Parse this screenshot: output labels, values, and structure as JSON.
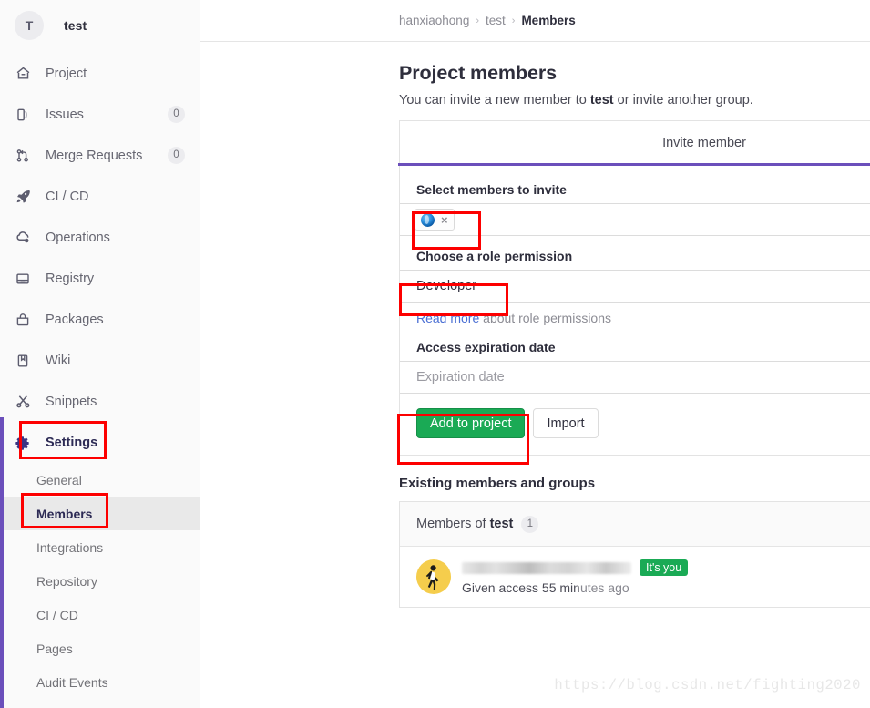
{
  "sidebar": {
    "project": {
      "initial": "T",
      "name": "test"
    },
    "nav": [
      {
        "label": "Project",
        "icon": "home-icon",
        "count": null
      },
      {
        "label": "Issues",
        "icon": "issues-icon",
        "count": "0"
      },
      {
        "label": "Merge Requests",
        "icon": "merge-request-icon",
        "count": "0"
      },
      {
        "label": "CI / CD",
        "icon": "rocket-icon",
        "count": null
      },
      {
        "label": "Operations",
        "icon": "cloud-gear-icon",
        "count": null
      },
      {
        "label": "Registry",
        "icon": "package-box-icon",
        "count": null
      },
      {
        "label": "Packages",
        "icon": "packages-icon",
        "count": null
      },
      {
        "label": "Wiki",
        "icon": "book-icon",
        "count": null
      },
      {
        "label": "Snippets",
        "icon": "scissors-icon",
        "count": null
      }
    ],
    "settings": {
      "label": "Settings",
      "icon": "gear-icon"
    },
    "sub_items": [
      {
        "label": "General",
        "active": false
      },
      {
        "label": "Members",
        "active": true
      },
      {
        "label": "Integrations",
        "active": false
      },
      {
        "label": "Repository",
        "active": false
      },
      {
        "label": "CI / CD",
        "active": false
      },
      {
        "label": "Pages",
        "active": false
      },
      {
        "label": "Audit Events",
        "active": false
      }
    ]
  },
  "breadcrumb": {
    "group": "hanxiaohong",
    "project": "test",
    "current": "Members",
    "separator": "›"
  },
  "page": {
    "title": "Project members",
    "subtitle_pre": "You can invite a new member to ",
    "subtitle_bold": "test",
    "subtitle_post": " or invite another group."
  },
  "invite": {
    "tab_label": "Invite member",
    "members_label": "Select members to invite",
    "token_remove": "×",
    "role_label": "Choose a role permission",
    "role_value": "Developer",
    "read_more_link": "Read more",
    "read_more_rest": " about role permissions",
    "expiration_label": "Access expiration date",
    "expiration_placeholder": "Expiration date",
    "submit_label": "Add to project",
    "import_label": "Import"
  },
  "existing": {
    "section_title": "Existing members and groups",
    "header_pre": "Members of",
    "header_project": "test",
    "header_count": "1",
    "rows": [
      {
        "name_redacted": true,
        "badge": "It's you",
        "meta": "Given access 55 minutes ago"
      }
    ]
  },
  "watermark": "https://blog.csdn.net/fighting2020",
  "colors": {
    "accent_purple": "#6b4fbb",
    "primary_green": "#1aaa55",
    "annotation_red": "#fd0000",
    "link_blue": "#4a6fd4"
  }
}
